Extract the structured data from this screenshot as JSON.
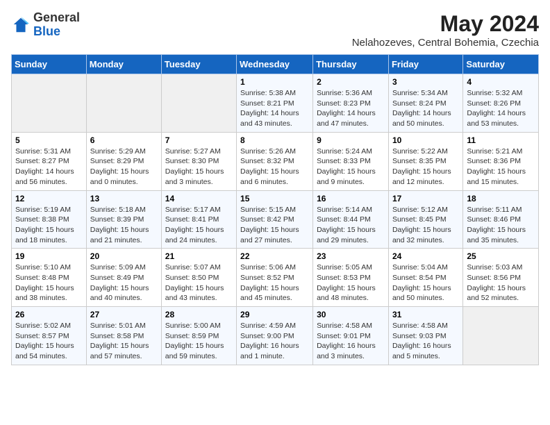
{
  "logo": {
    "general": "General",
    "blue": "Blue"
  },
  "title": {
    "month_year": "May 2024",
    "location": "Nelahozeves, Central Bohemia, Czechia"
  },
  "days_of_week": [
    "Sunday",
    "Monday",
    "Tuesday",
    "Wednesday",
    "Thursday",
    "Friday",
    "Saturday"
  ],
  "weeks": [
    [
      {
        "day": "",
        "info": ""
      },
      {
        "day": "",
        "info": ""
      },
      {
        "day": "",
        "info": ""
      },
      {
        "day": "1",
        "info": "Sunrise: 5:38 AM\nSunset: 8:21 PM\nDaylight: 14 hours\nand 43 minutes."
      },
      {
        "day": "2",
        "info": "Sunrise: 5:36 AM\nSunset: 8:23 PM\nDaylight: 14 hours\nand 47 minutes."
      },
      {
        "day": "3",
        "info": "Sunrise: 5:34 AM\nSunset: 8:24 PM\nDaylight: 14 hours\nand 50 minutes."
      },
      {
        "day": "4",
        "info": "Sunrise: 5:32 AM\nSunset: 8:26 PM\nDaylight: 14 hours\nand 53 minutes."
      }
    ],
    [
      {
        "day": "5",
        "info": "Sunrise: 5:31 AM\nSunset: 8:27 PM\nDaylight: 14 hours\nand 56 minutes."
      },
      {
        "day": "6",
        "info": "Sunrise: 5:29 AM\nSunset: 8:29 PM\nDaylight: 15 hours\nand 0 minutes."
      },
      {
        "day": "7",
        "info": "Sunrise: 5:27 AM\nSunset: 8:30 PM\nDaylight: 15 hours\nand 3 minutes."
      },
      {
        "day": "8",
        "info": "Sunrise: 5:26 AM\nSunset: 8:32 PM\nDaylight: 15 hours\nand 6 minutes."
      },
      {
        "day": "9",
        "info": "Sunrise: 5:24 AM\nSunset: 8:33 PM\nDaylight: 15 hours\nand 9 minutes."
      },
      {
        "day": "10",
        "info": "Sunrise: 5:22 AM\nSunset: 8:35 PM\nDaylight: 15 hours\nand 12 minutes."
      },
      {
        "day": "11",
        "info": "Sunrise: 5:21 AM\nSunset: 8:36 PM\nDaylight: 15 hours\nand 15 minutes."
      }
    ],
    [
      {
        "day": "12",
        "info": "Sunrise: 5:19 AM\nSunset: 8:38 PM\nDaylight: 15 hours\nand 18 minutes."
      },
      {
        "day": "13",
        "info": "Sunrise: 5:18 AM\nSunset: 8:39 PM\nDaylight: 15 hours\nand 21 minutes."
      },
      {
        "day": "14",
        "info": "Sunrise: 5:17 AM\nSunset: 8:41 PM\nDaylight: 15 hours\nand 24 minutes."
      },
      {
        "day": "15",
        "info": "Sunrise: 5:15 AM\nSunset: 8:42 PM\nDaylight: 15 hours\nand 27 minutes."
      },
      {
        "day": "16",
        "info": "Sunrise: 5:14 AM\nSunset: 8:44 PM\nDaylight: 15 hours\nand 29 minutes."
      },
      {
        "day": "17",
        "info": "Sunrise: 5:12 AM\nSunset: 8:45 PM\nDaylight: 15 hours\nand 32 minutes."
      },
      {
        "day": "18",
        "info": "Sunrise: 5:11 AM\nSunset: 8:46 PM\nDaylight: 15 hours\nand 35 minutes."
      }
    ],
    [
      {
        "day": "19",
        "info": "Sunrise: 5:10 AM\nSunset: 8:48 PM\nDaylight: 15 hours\nand 38 minutes."
      },
      {
        "day": "20",
        "info": "Sunrise: 5:09 AM\nSunset: 8:49 PM\nDaylight: 15 hours\nand 40 minutes."
      },
      {
        "day": "21",
        "info": "Sunrise: 5:07 AM\nSunset: 8:50 PM\nDaylight: 15 hours\nand 43 minutes."
      },
      {
        "day": "22",
        "info": "Sunrise: 5:06 AM\nSunset: 8:52 PM\nDaylight: 15 hours\nand 45 minutes."
      },
      {
        "day": "23",
        "info": "Sunrise: 5:05 AM\nSunset: 8:53 PM\nDaylight: 15 hours\nand 48 minutes."
      },
      {
        "day": "24",
        "info": "Sunrise: 5:04 AM\nSunset: 8:54 PM\nDaylight: 15 hours\nand 50 minutes."
      },
      {
        "day": "25",
        "info": "Sunrise: 5:03 AM\nSunset: 8:56 PM\nDaylight: 15 hours\nand 52 minutes."
      }
    ],
    [
      {
        "day": "26",
        "info": "Sunrise: 5:02 AM\nSunset: 8:57 PM\nDaylight: 15 hours\nand 54 minutes."
      },
      {
        "day": "27",
        "info": "Sunrise: 5:01 AM\nSunset: 8:58 PM\nDaylight: 15 hours\nand 57 minutes."
      },
      {
        "day": "28",
        "info": "Sunrise: 5:00 AM\nSunset: 8:59 PM\nDaylight: 15 hours\nand 59 minutes."
      },
      {
        "day": "29",
        "info": "Sunrise: 4:59 AM\nSunset: 9:00 PM\nDaylight: 16 hours\nand 1 minute."
      },
      {
        "day": "30",
        "info": "Sunrise: 4:58 AM\nSunset: 9:01 PM\nDaylight: 16 hours\nand 3 minutes."
      },
      {
        "day": "31",
        "info": "Sunrise: 4:58 AM\nSunset: 9:03 PM\nDaylight: 16 hours\nand 5 minutes."
      },
      {
        "day": "",
        "info": ""
      }
    ]
  ]
}
